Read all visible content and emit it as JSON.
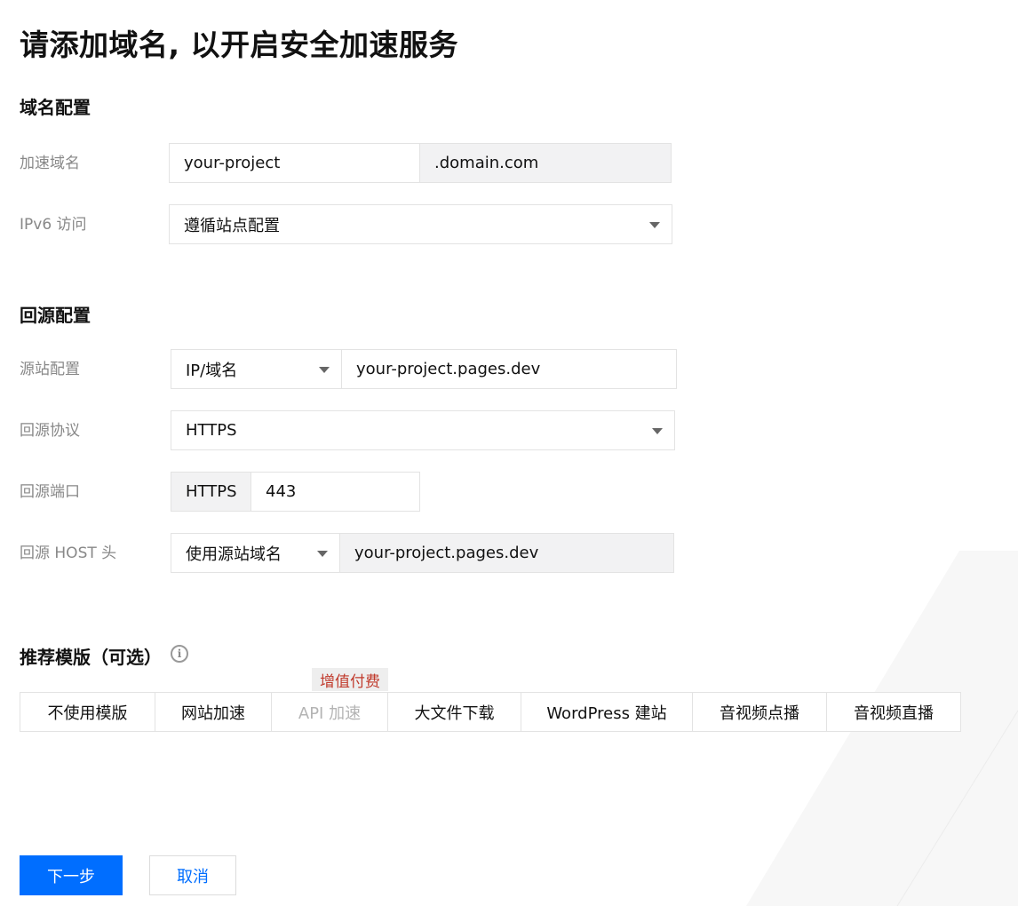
{
  "page_title": "请添加域名, 以开启安全加速服务",
  "domain_section": {
    "title": "域名配置",
    "accel_domain": {
      "label": "加速域名",
      "value": "your-project",
      "suffix": ".domain.com"
    },
    "ipv6": {
      "label": "IPv6 访问",
      "value": "遵循站点配置"
    }
  },
  "origin_section": {
    "title": "回源配置",
    "origin": {
      "label": "源站配置",
      "type_value": "IP/域名",
      "value": "your-project.pages.dev"
    },
    "protocol": {
      "label": "回源协议",
      "value": "HTTPS"
    },
    "port": {
      "label": "回源端口",
      "prefix": "HTTPS",
      "value": "443"
    },
    "host": {
      "label": "回源 HOST 头",
      "mode_value": "使用源站域名",
      "value": "your-project.pages.dev"
    }
  },
  "templates": {
    "title": "推荐模版（可选）",
    "paid_tag": "增值付费",
    "items": [
      {
        "label": "不使用模版"
      },
      {
        "label": "网站加速"
      },
      {
        "label": "API 加速"
      },
      {
        "label": "大文件下载"
      },
      {
        "label": "WordPress 建站"
      },
      {
        "label": "音视频点播"
      },
      {
        "label": "音视频直播"
      }
    ]
  },
  "actions": {
    "next": "下一步",
    "cancel": "取消"
  },
  "colors": {
    "primary": "#006eff",
    "paid_tag_text": "#c0392b",
    "label_grey": "#888888",
    "border": "#e3e3e3"
  },
  "icons": {
    "info": "info-circle-icon",
    "dropdown": "caret-down-icon"
  }
}
